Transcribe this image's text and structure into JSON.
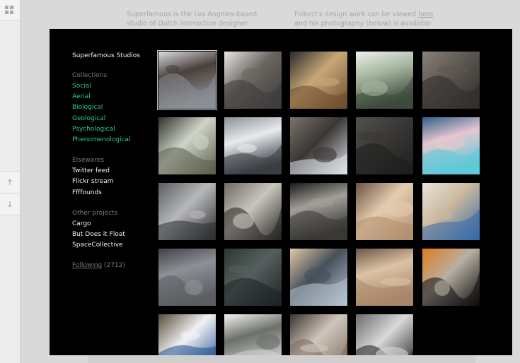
{
  "background_page": {
    "col1_text": "Superfamous is the Los Angeles-based studio of Dutch interaction designer Folkert Gorter.",
    "col2_text_before": "Folkert's design work can be viewed ",
    "col2_link": "here",
    "col2_text_after": " and his photography (below) is available under the"
  },
  "rail": {
    "grid_icon": "grid-icon",
    "up_icon": "↑",
    "down_icon": "↓"
  },
  "sidebar": {
    "title": "Superfamous Studios",
    "collections": {
      "heading": "Collections",
      "items": [
        "Social",
        "Aerial",
        "Biological",
        "Geological",
        "Psychological",
        "Phenomenological"
      ]
    },
    "elsewares": {
      "heading": "Elsewares",
      "items": [
        "Twitter feed",
        "Flickr stream",
        "Ffffounds"
      ]
    },
    "other_projects": {
      "heading": "Other projects",
      "items": [
        "Cargo",
        "But Does it Float",
        "SpaceCollective"
      ]
    },
    "following_label": "Following",
    "following_count": "(2712)"
  },
  "colors": {
    "accent_teal": "#29c99b",
    "modal_bg": "#000000"
  },
  "gallery": {
    "thumbnails": [
      {
        "subject": "aerial-coast-mountains",
        "c1": "#8a8f96",
        "c2": "#4a3f3a",
        "c3": "#d8dde2"
      },
      {
        "subject": "dark-rock-cliff",
        "c1": "#3c3a3a",
        "c2": "#6b6560",
        "c3": "#e8e6e4"
      },
      {
        "subject": "tide-pool-rocks",
        "c1": "#6b4a2c",
        "c2": "#c8a878",
        "c3": "#2b2a2c"
      },
      {
        "subject": "cypress-tree",
        "c1": "#3d4a3c",
        "c2": "#a7b6a0",
        "c3": "#eef1ee"
      },
      {
        "subject": "rock-crevice",
        "c1": "#2f2c2a",
        "c2": "#5c5650",
        "c3": "#88817a"
      },
      {
        "subject": "birch-trees",
        "c1": "#5a5f4a",
        "c2": "#cfd3c8",
        "c3": "#2e3128"
      },
      {
        "subject": "crashing-waves",
        "c1": "#3a3e44",
        "c2": "#e8ebee",
        "c3": "#8a9098"
      },
      {
        "subject": "sea-rock-sky",
        "c1": "#dfe4ea",
        "c2": "#3a3634",
        "c3": "#7b736c"
      },
      {
        "subject": "dark-lava-rock",
        "c1": "#1e1d1c",
        "c2": "#3b3937",
        "c3": "#52504c"
      },
      {
        "subject": "pink-water-abstract",
        "c1": "#5ec9d8",
        "c2": "#e5c7cf",
        "c3": "#2f5e8a"
      },
      {
        "subject": "storm-clouds",
        "c1": "#2a2b2d",
        "c2": "#b7b8ba",
        "c3": "#5a5c5f"
      },
      {
        "subject": "calla-lily-petal",
        "c1": "#262522",
        "c2": "#c8c5bd",
        "c3": "#6f6b63"
      },
      {
        "subject": "leaf-veins",
        "c1": "#3a3835",
        "c2": "#a29f98",
        "c3": "#1a1918"
      },
      {
        "subject": "sandstone-texture",
        "c1": "#b08d6c",
        "c2": "#e3ccb0",
        "c3": "#6e5340"
      },
      {
        "subject": "beach-aerial",
        "c1": "#3569a8",
        "c2": "#c9b79d",
        "c3": "#e9e4da"
      },
      {
        "subject": "ocean-surface",
        "c1": "#5b5e62",
        "c2": "#8d9196",
        "c3": "#3f4245"
      },
      {
        "subject": "kelp-strands",
        "c1": "#1d2224",
        "c2": "#55605e",
        "c3": "#2e3633"
      },
      {
        "subject": "coast-sunset",
        "c1": "#b8c4d2",
        "c2": "#46505a",
        "c3": "#e2c7a4"
      },
      {
        "subject": "eroded-rock",
        "c1": "#a98669",
        "c2": "#dcc3a6",
        "c3": "#6e5544"
      },
      {
        "subject": "glowing-abstract",
        "c1": "#0d0d0d",
        "c2": "#b8b0a2",
        "c3": "#e07a1f"
      },
      {
        "subject": "mountain-clouds",
        "c1": "#1f4e8c",
        "c2": "#f1f2f4",
        "c3": "#5a4a3a"
      },
      {
        "subject": "foggy-hill",
        "c1": "#cfd2d4",
        "c2": "#6c7068",
        "c3": "#f4f4f2"
      },
      {
        "subject": "rock-boulders",
        "c1": "#7a6a5e",
        "c2": "#cfc6bc",
        "c3": "#3c332d"
      },
      {
        "subject": "granite-crystals",
        "c1": "#1a1a1a",
        "c2": "#d9d9d9",
        "c3": "#6b6b6b"
      }
    ]
  }
}
